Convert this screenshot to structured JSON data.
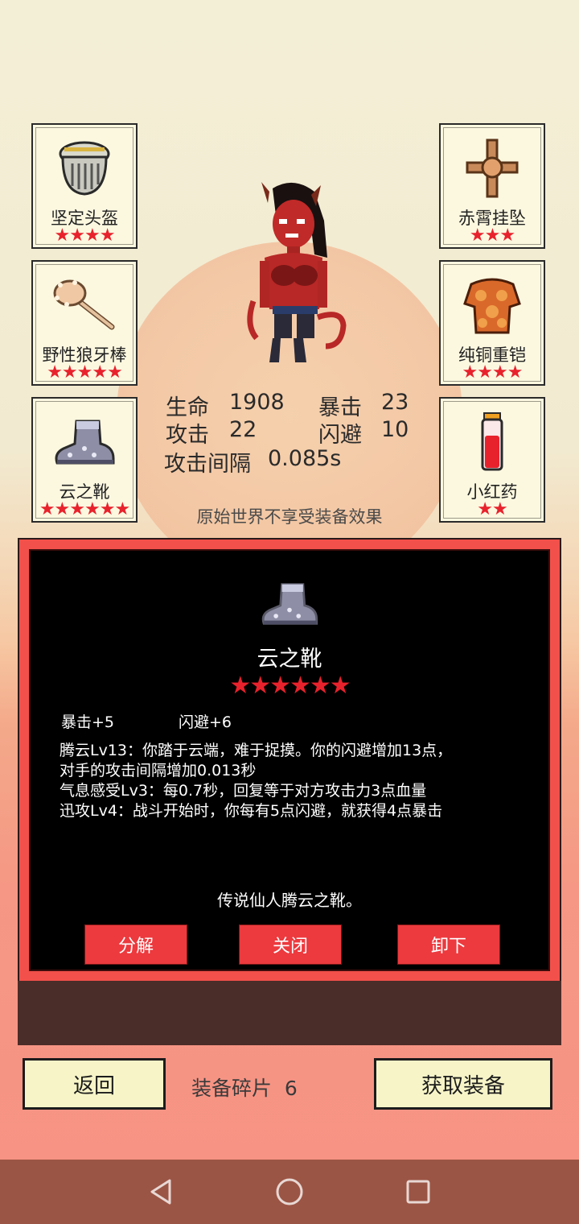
{
  "slots": {
    "left": [
      {
        "name": "坚定头盔",
        "stars": "★★★★"
      },
      {
        "name": "野性狼牙棒",
        "stars": "★★★★★"
      },
      {
        "name": "云之靴",
        "stars": "★★★★★★"
      }
    ],
    "right": [
      {
        "name": "赤霄挂坠",
        "stars": "★★★"
      },
      {
        "name": "纯铜重铠",
        "stars": "★★★★"
      },
      {
        "name": "小红药",
        "stars": "★★"
      }
    ]
  },
  "stats": {
    "hp_label": "生命",
    "hp": "1908",
    "crit_label": "暴击",
    "crit": "23",
    "atk_label": "攻击",
    "atk": "22",
    "dodge_label": "闪避",
    "dodge": "10",
    "interval_label": "攻击间隔",
    "interval": "0.085s"
  },
  "note": "原始世界不享受装备效果",
  "detail": {
    "name": "云之靴",
    "stars": "★★★★★★",
    "attr1": "暴击+5",
    "attr2": "闪避+6",
    "desc": [
      "腾云Lv13：你踏于云端，难于捉摸。你的闪避增加13点，",
      "对手的攻击间隔增加0.013秒",
      "气息感受Lv3：每0.7秒，回复等于对方攻击力3点血量",
      "迅攻Lv4：战斗开始时，你每有5点闪避，就获得4点暴击"
    ],
    "legend": "传说仙人腾云之靴。",
    "buttons": {
      "decompose": "分解",
      "close": "关闭",
      "unequip": "卸下"
    }
  },
  "bottom": {
    "back": "返回",
    "fragments_label": "装备碎片",
    "fragments": "6",
    "get": "获取装备"
  },
  "colors": {
    "star": "#e8222c",
    "panel": "#f2504a",
    "button": "#ec3a3e"
  }
}
